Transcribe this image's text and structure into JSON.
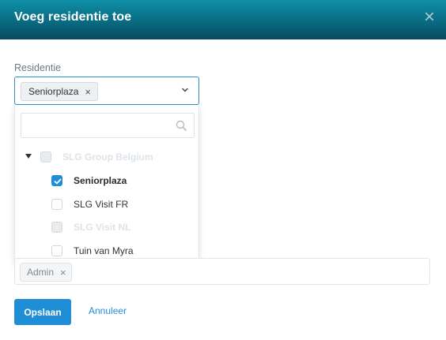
{
  "dialog": {
    "title": "Voeg residentie toe",
    "close_icon": "close-icon"
  },
  "residence_field": {
    "label": "Residentie",
    "selected_chip": "Seniorplaza",
    "chip_remove": "×",
    "dropdown_icon": "chevron-down-icon"
  },
  "dropdown": {
    "search_value": "",
    "search_icon": "search-icon",
    "tree": [
      {
        "label": "SLG Group Belgium",
        "state": "disabled",
        "expanded": true
      },
      {
        "label": "Seniorplaza",
        "state": "checked"
      },
      {
        "label": "SLG Visit FR",
        "state": "unchecked"
      },
      {
        "label": "SLG Visit NL",
        "state": "disabled"
      },
      {
        "label": "Tuin van Myra",
        "state": "unchecked"
      }
    ]
  },
  "roles_field": {
    "chip": "Admin",
    "chip_remove": "×"
  },
  "actions": {
    "save": "Opslaan",
    "cancel": "Annuleer"
  },
  "colors": {
    "header_gradient_top": "#0e8fa6",
    "header_gradient_bottom": "#064b5d",
    "accent": "#1f8ed6"
  }
}
